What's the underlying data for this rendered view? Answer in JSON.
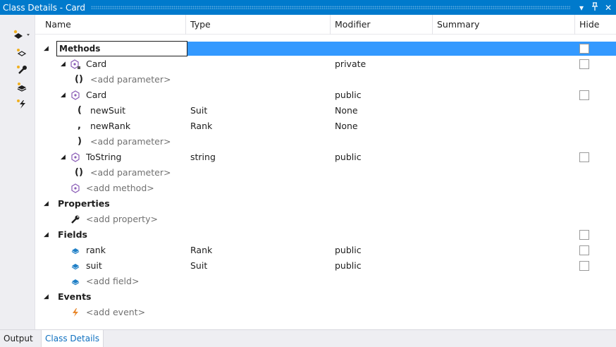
{
  "window": {
    "title": "Class Details - Card",
    "dropdown_glyph": "▾",
    "pin_glyph": "ꟸ",
    "close_glyph": "✕"
  },
  "columns": {
    "name": "Name",
    "type": "Type",
    "modifier": "Modifier",
    "summary": "Summary",
    "hide": "Hide"
  },
  "rows": [
    {
      "kind": "section-selected",
      "name": "Methods",
      "hide_checkbox": true
    },
    {
      "kind": "method",
      "name": "Card",
      "type": "",
      "modifier": "private",
      "hide_checkbox": true,
      "icon": "private-method-icon"
    },
    {
      "kind": "param",
      "glyph": "()",
      "name": "<add parameter>",
      "placeholder": true
    },
    {
      "kind": "method",
      "name": "Card",
      "type": "",
      "modifier": "public",
      "hide_checkbox": true,
      "icon": "method-icon"
    },
    {
      "kind": "param",
      "glyph": "(",
      "name": "newSuit",
      "type": "Suit",
      "modifier": "None"
    },
    {
      "kind": "param",
      "glyph": ",",
      "name": "newRank",
      "type": "Rank",
      "modifier": "None"
    },
    {
      "kind": "param",
      "glyph": ")",
      "name": "<add parameter>",
      "placeholder": true
    },
    {
      "kind": "method",
      "name": "ToString",
      "type": "string",
      "modifier": "public",
      "hide_checkbox": true,
      "icon": "method-icon"
    },
    {
      "kind": "param",
      "glyph": "()",
      "name": "<add parameter>",
      "placeholder": true
    },
    {
      "kind": "add",
      "name": "<add method>",
      "icon": "add-method-icon"
    },
    {
      "kind": "section",
      "name": "Properties"
    },
    {
      "kind": "add",
      "name": "<add property>",
      "icon": "wrench-icon"
    },
    {
      "kind": "section",
      "name": "Fields",
      "hide_checkbox": true
    },
    {
      "kind": "field",
      "name": "rank",
      "type": "Rank",
      "modifier": "public",
      "hide_checkbox": true,
      "icon": "field-icon"
    },
    {
      "kind": "field",
      "name": "suit",
      "type": "Suit",
      "modifier": "public",
      "hide_checkbox": true,
      "icon": "field-icon"
    },
    {
      "kind": "add",
      "name": "<add field>",
      "icon": "field-icon"
    },
    {
      "kind": "section",
      "name": "Events"
    },
    {
      "kind": "add",
      "name": "<add event>",
      "icon": "event-icon"
    }
  ],
  "tabs": [
    {
      "label": "Output",
      "active": false
    },
    {
      "label": "Class Details",
      "active": true
    }
  ],
  "colors": {
    "accent": "#007acc",
    "selection": "#3399ff",
    "method_icon": "#8a5cb6",
    "field_icon": "#1f7fc6",
    "event_icon": "#e8862a"
  }
}
